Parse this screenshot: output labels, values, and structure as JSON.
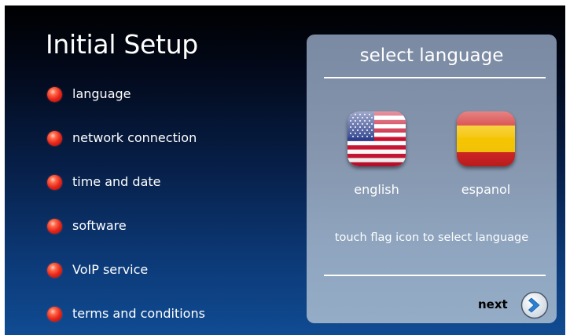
{
  "setup": {
    "title": "Initial Setup",
    "steps": [
      {
        "label": "language"
      },
      {
        "label": "network connection"
      },
      {
        "label": "time and date"
      },
      {
        "label": "software"
      },
      {
        "label": "VoIP service"
      },
      {
        "label": "terms and conditions"
      }
    ]
  },
  "language_panel": {
    "title": "select language",
    "options": [
      {
        "label": "english",
        "icon": "us-flag-icon"
      },
      {
        "label": "espanol",
        "icon": "spain-flag-icon"
      }
    ],
    "hint": "touch flag icon to select language",
    "next_label": "next"
  },
  "colors": {
    "step_bullet": "#e8261a",
    "panel_background": "#8595ad",
    "next_arrow": "#2a7fd0"
  }
}
